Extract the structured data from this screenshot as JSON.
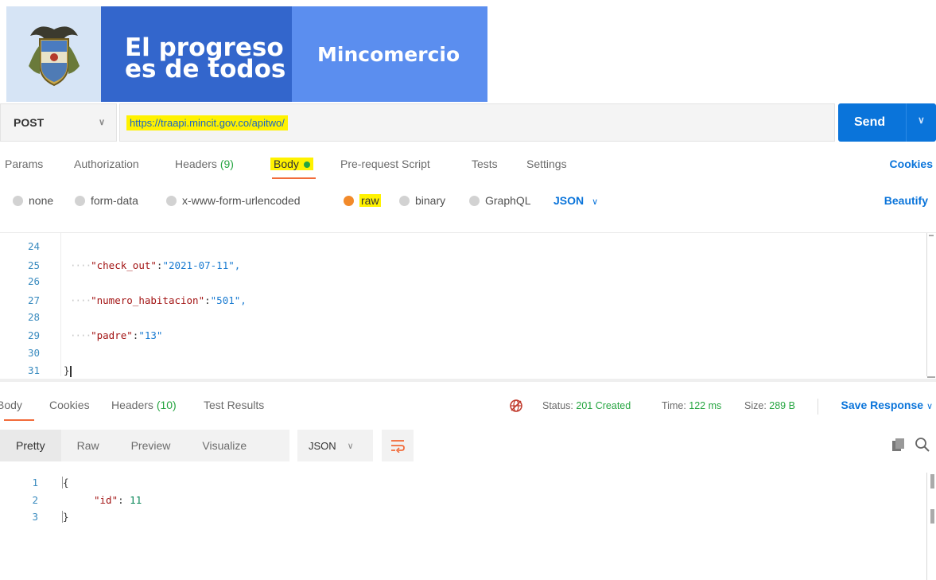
{
  "banner": {
    "slogan_line1": "El progreso",
    "slogan_line2": "es de todos",
    "brand": "Mincomercio",
    "seal_icon": "colombia-coat-of-arms-icon",
    "colors": {
      "slogan_bg": "#3366cc",
      "brand_bg": "#5b8eef",
      "seal_bg": "#d6e4f5"
    }
  },
  "request": {
    "method": "POST",
    "url": "https://traapi.mincit.gov.co/apitwo/",
    "send_label": "Send"
  },
  "request_tabs": {
    "params": "Params",
    "authorization": "Authorization",
    "headers": "Headers",
    "headers_count": "(9)",
    "body": "Body",
    "prerequest": "Pre-request Script",
    "tests": "Tests",
    "settings": "Settings",
    "cookies": "Cookies"
  },
  "body_types": {
    "none": "none",
    "form_data": "form-data",
    "urlencoded": "x-www-form-urlencoded",
    "raw": "raw",
    "binary": "binary",
    "graphql": "GraphQL",
    "format": "JSON",
    "beautify": "Beautify",
    "selected": "raw"
  },
  "request_body": {
    "lines": [
      {
        "n": "24",
        "key": "",
        "value": ""
      },
      {
        "n": "25",
        "key": "\"check_out\"",
        "value": "\"2021-07-11\","
      },
      {
        "n": "26",
        "key": "",
        "value": ""
      },
      {
        "n": "27",
        "key": "\"numero_habitacion\"",
        "value": "\"501\","
      },
      {
        "n": "28",
        "key": "",
        "value": ""
      },
      {
        "n": "29",
        "key": "\"padre\"",
        "value": "\"13\""
      },
      {
        "n": "30",
        "key": "",
        "value": ""
      },
      {
        "n": "31",
        "key": "",
        "value": "}"
      }
    ],
    "indent_dots": "····"
  },
  "response_tabs": {
    "body": "Body",
    "cookies": "Cookies",
    "headers": "Headers",
    "headers_count": "(10)",
    "test_results": "Test Results",
    "status_label": "Status:",
    "status_value": "201 Created",
    "time_label": "Time:",
    "time_value": "122 ms",
    "size_label": "Size:",
    "size_value": "289 B",
    "save_response": "Save Response"
  },
  "response_toolbar": {
    "pretty": "Pretty",
    "raw": "Raw",
    "preview": "Preview",
    "visualize": "Visualize",
    "format": "JSON"
  },
  "response_body": {
    "lines": [
      {
        "n": "1",
        "text": "{"
      },
      {
        "n": "2",
        "key": "\"id\"",
        "value": "11"
      },
      {
        "n": "3",
        "text": "}"
      }
    ]
  }
}
